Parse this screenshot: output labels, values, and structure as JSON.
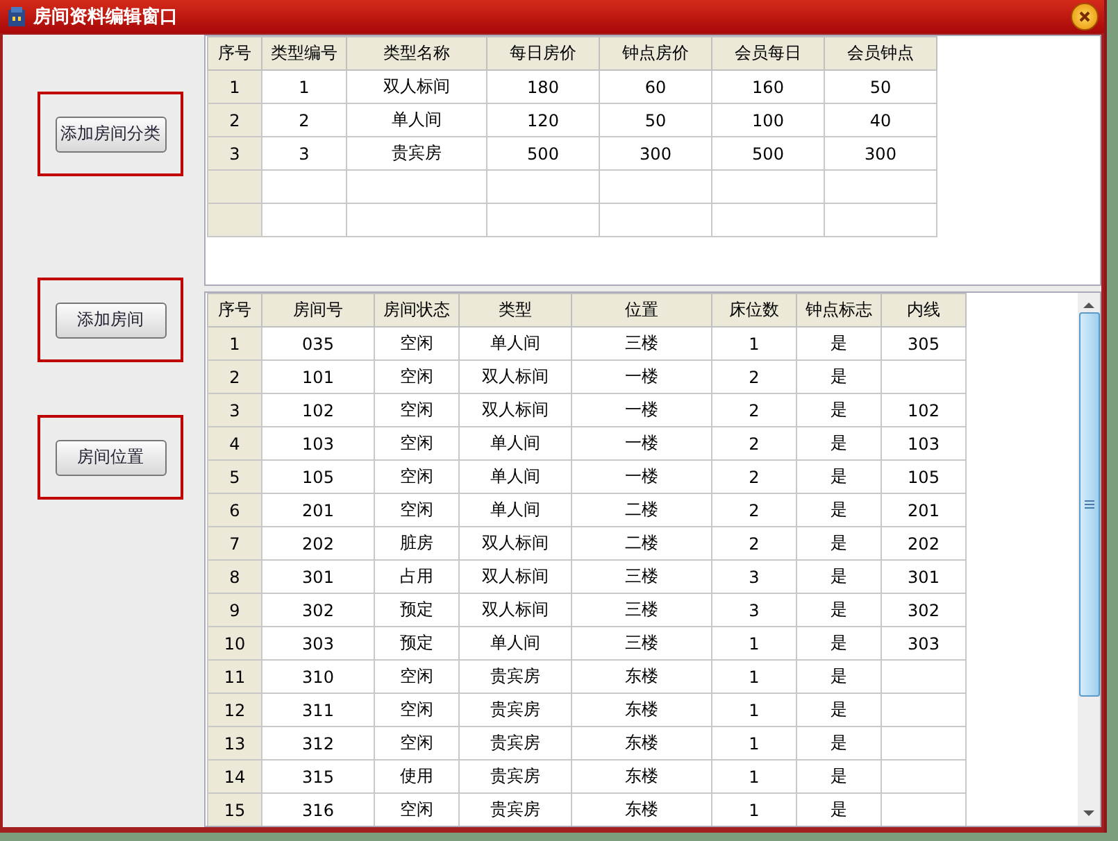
{
  "window": {
    "title": "房间资料编辑窗口"
  },
  "buttons": [
    "添加房间分类",
    "添加房间",
    "房间位置"
  ],
  "room_types": {
    "columns": [
      "序号",
      "类型编号",
      "类型名称",
      "每日房价",
      "钟点房价",
      "会员每日",
      "会员钟点"
    ],
    "rows": [
      [
        "1",
        "1",
        "双人标间",
        "180",
        "60",
        "160",
        "50"
      ],
      [
        "2",
        "2",
        "单人间",
        "120",
        "50",
        "100",
        "40"
      ],
      [
        "3",
        "3",
        "贵宾房",
        "500",
        "300",
        "500",
        "300"
      ]
    ]
  },
  "rooms": {
    "columns": [
      "序号",
      "房间号",
      "房间状态",
      "类型",
      "位置",
      "床位数",
      "钟点标志",
      "内线"
    ],
    "rows": [
      [
        "1",
        "035",
        "空闲",
        "单人间",
        "三楼",
        "1",
        "是",
        "305"
      ],
      [
        "2",
        "101",
        "空闲",
        "双人标间",
        "一楼",
        "2",
        "是",
        null
      ],
      [
        "3",
        "102",
        "空闲",
        "双人标间",
        "一楼",
        "2",
        "是",
        "102"
      ],
      [
        "4",
        "103",
        "空闲",
        "单人间",
        "一楼",
        "2",
        "是",
        "103"
      ],
      [
        "5",
        "105",
        "空闲",
        "单人间",
        "一楼",
        "2",
        "是",
        "105"
      ],
      [
        "6",
        "201",
        "空闲",
        "单人间",
        "二楼",
        "2",
        "是",
        "201"
      ],
      [
        "7",
        "202",
        "脏房",
        "双人标间",
        "二楼",
        "2",
        "是",
        "202"
      ],
      [
        "8",
        "301",
        "占用",
        "双人标间",
        "三楼",
        "3",
        "是",
        "301"
      ],
      [
        "9",
        "302",
        "预定",
        "双人标间",
        "三楼",
        "3",
        "是",
        "302"
      ],
      [
        "10",
        "303",
        "预定",
        "单人间",
        "三楼",
        "1",
        "是",
        "303"
      ],
      [
        "11",
        "310",
        "空闲",
        "贵宾房",
        "东楼",
        "1",
        "是",
        null
      ],
      [
        "12",
        "311",
        "空闲",
        "贵宾房",
        "东楼",
        "1",
        "是",
        null
      ],
      [
        "13",
        "312",
        "空闲",
        "贵宾房",
        "东楼",
        "1",
        "是",
        null
      ],
      [
        "14",
        "315",
        "使用",
        "贵宾房",
        "东楼",
        "1",
        "是",
        null
      ],
      [
        "15",
        "316",
        "空闲",
        "贵宾房",
        "东楼",
        "1",
        "是",
        null
      ]
    ]
  }
}
